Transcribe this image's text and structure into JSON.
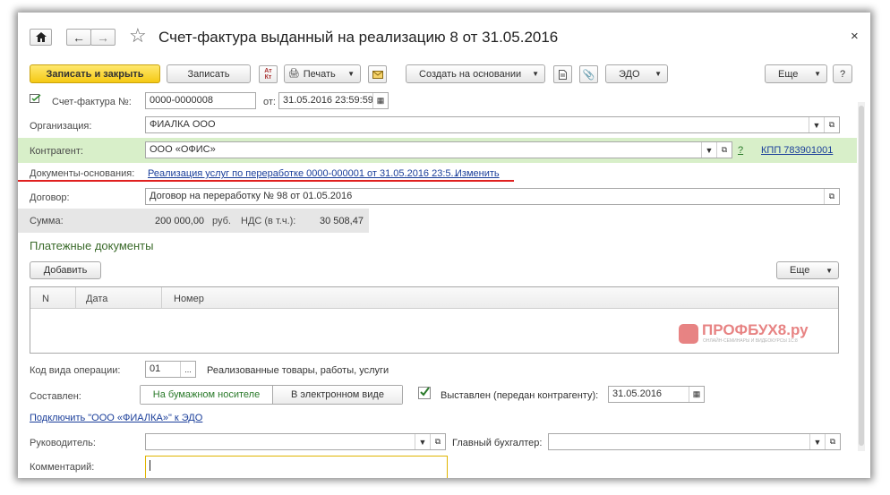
{
  "window": {
    "title": "Счет-фактура выданный на реализацию 8 от 31.05.2016",
    "close": "×"
  },
  "toolbar": {
    "save_close": "Записать и закрыть",
    "save": "Записать",
    "print": "Печать",
    "create_based": "Создать на основании",
    "edo": "ЭДО",
    "more": "Еще",
    "help": "?"
  },
  "form": {
    "invoice_label": "Счет-фактура №:",
    "invoice_number": "0000-0000008",
    "from_label": "от:",
    "invoice_date": "31.05.2016 23:59:59",
    "org_label": "Организация:",
    "org_value": "ФИАЛКА ООО",
    "contractor_label": "Контрагент:",
    "contractor_value": "ООО «ОФИС»",
    "question": "?",
    "kpp_link": "КПП 783901001",
    "docs_label": "Документы-основания:",
    "docs_link": "Реализация услуг по переработке 0000-000001 от 31.05.2016 23:5...",
    "change_link": "Изменить",
    "contract_label": "Договор:",
    "contract_value": "Договор на переработку № 98 от 01.05.2016",
    "sum_label": "Сумма:",
    "sum_value": "200 000,00",
    "currency": "руб.",
    "vat_label": "НДС (в т.ч.):",
    "vat_value": "30 508,47"
  },
  "payments": {
    "heading": "Платежные документы",
    "add_button": "Добавить",
    "more": "Еще",
    "columns": [
      "N",
      "Дата",
      "Номер"
    ]
  },
  "watermark": {
    "logo": "ПРОФБУХ8.ру",
    "sub": "ОНЛАЙН-СЕМИНАРЫ И ВИДЕОКУРСЫ 1С:8"
  },
  "operation": {
    "code_label": "Код вида операции:",
    "code_value": "01",
    "code_desc": "Реализованные товары, работы, услуги",
    "composed_label": "Составлен:",
    "paper": "На бумажном носителе",
    "electronic": "В электронном виде",
    "issued_label": "Выставлен (передан контрагенту):",
    "issued_date": "31.05.2016",
    "edo_link": "Подключить \"ООО «ФИАЛКА»\" к ЭДО"
  },
  "signers": {
    "head_label": "Руководитель:",
    "chief_label": "Главный бухгалтер:",
    "comment_label": "Комментарий:"
  },
  "colors": {
    "accent_yellow": "#f5c914",
    "highlight_green": "#d8efc9",
    "red_underline": "#e0201f",
    "link_blue": "#1a3e9a",
    "watermark_red": "#e05a5a"
  }
}
